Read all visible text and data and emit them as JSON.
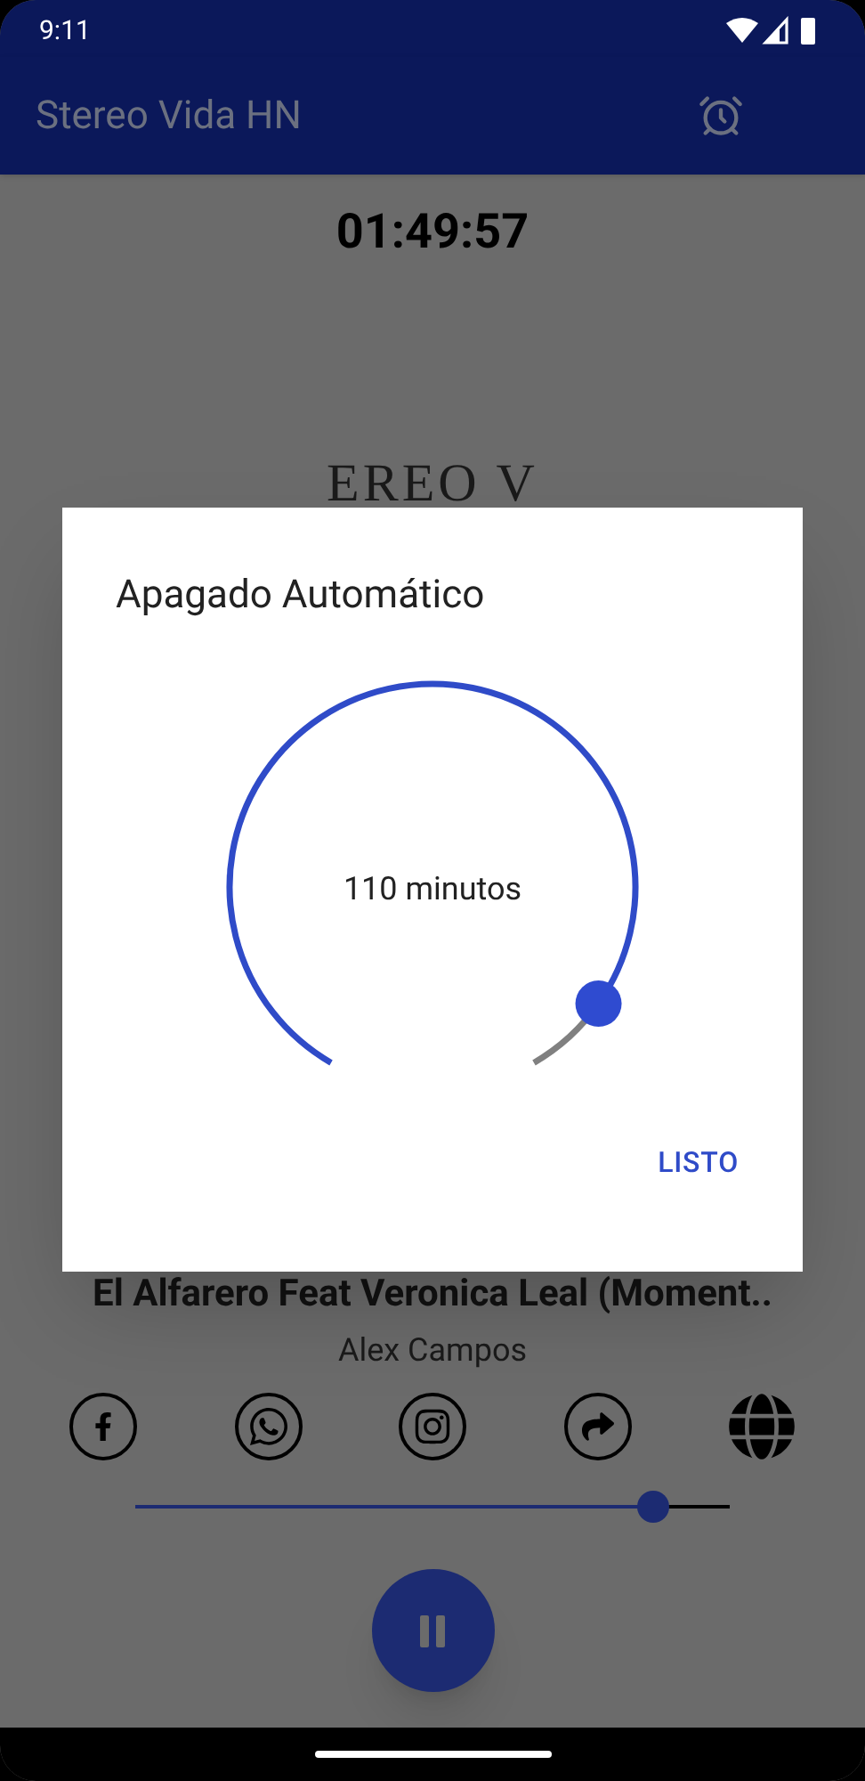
{
  "status_bar": {
    "time": "9:11"
  },
  "app_bar": {
    "title": "Stereo Vida HN"
  },
  "timer": "01:49:57",
  "logo_text": "EREO V",
  "dialog": {
    "title": "Apagado Automático",
    "dial": {
      "level": 0.917,
      "reading": "110 minutos"
    },
    "button": "LISTO"
  },
  "now_playing": {
    "title": "El Alfarero Feat Veronica Leal (Moment..",
    "artist": "Alex Campos"
  },
  "social_icons": [
    {
      "kind": "facebook"
    },
    {
      "kind": "whatsapp"
    },
    {
      "kind": "instagram"
    },
    {
      "kind": "share"
    },
    {
      "kind": "web"
    }
  ],
  "progress": {
    "level": 0.87
  },
  "player": {
    "playing": true
  }
}
